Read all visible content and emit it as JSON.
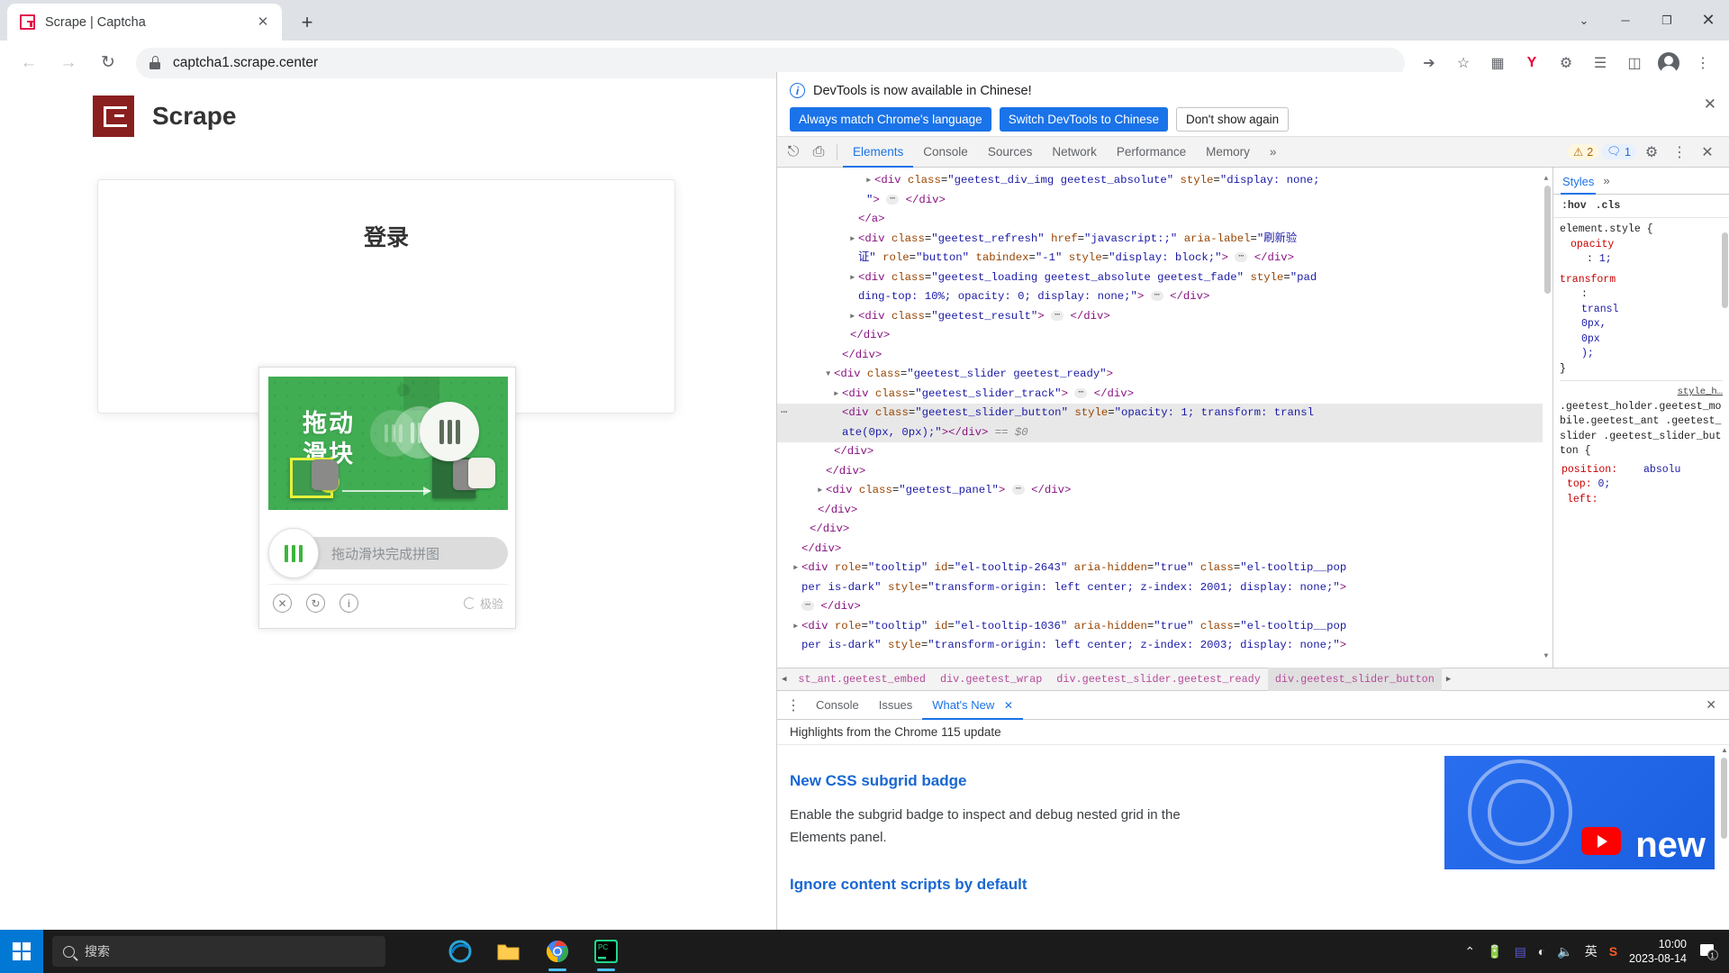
{
  "browser": {
    "tab": {
      "title": "Scrape | Captcha",
      "favicon": "scrape-logo-icon",
      "close": "✕"
    },
    "newtab_label": "+",
    "window_controls": {
      "minimize": "─",
      "maximize": "❐",
      "close": "✕",
      "chevron": "⌄"
    },
    "nav": {
      "back": "←",
      "forward": "→",
      "reload": "↻"
    },
    "omnibox": {
      "url": "captcha1.scrape.center",
      "lock": "lock-icon"
    },
    "toolbar_icons": [
      "share-icon",
      "star-icon",
      "extension-card-icon",
      "yandex-icon",
      "puzzle-icon",
      "reading-list-icon",
      "side-panel-icon",
      "profile-avatar-icon",
      "more-menu-icon"
    ]
  },
  "page": {
    "brand": "Scrape",
    "login_title": "登录",
    "captcha": {
      "image_text_line1": "拖动",
      "image_text_line2": "滑块",
      "slider_placeholder": "拖动滑块完成拼图",
      "footer_icons": [
        "close-icon",
        "refresh-icon",
        "info-icon"
      ],
      "brand": "极验",
      "bg_color": "#41ad53",
      "slider_bar_color": "#3db53d"
    }
  },
  "devtools": {
    "banner": {
      "text": "DevTools is now available in Chinese!",
      "buttons": [
        {
          "label": "Always match Chrome's language",
          "style": "blue"
        },
        {
          "label": "Switch DevTools to Chinese",
          "style": "blue"
        },
        {
          "label": "Don't show again",
          "style": "plain"
        }
      ],
      "close": "✕"
    },
    "tabs": [
      {
        "label": "Elements",
        "active": true
      },
      {
        "label": "Console",
        "active": false
      },
      {
        "label": "Sources",
        "active": false
      },
      {
        "label": "Network",
        "active": false
      },
      {
        "label": "Performance",
        "active": false
      },
      {
        "label": "Memory",
        "active": false
      }
    ],
    "tabs_overflow": "»",
    "badges": {
      "warnings": "2",
      "messages": "1"
    },
    "tab_icons": [
      "inspect-element-icon",
      "device-toolbar-icon",
      "settings-gear-icon",
      "devtools-more-icon",
      "devtools-close-icon"
    ],
    "dom_lines": [
      {
        "indent": 10,
        "tri": "closed",
        "html": "<span class=\"punc\">&lt;</span><span class=\"tagname\">div</span> <span class=\"attr\">class</span>=<span class=\"val\">\"geetest_div_img geetest_absolute\"</span> <span class=\"attr\">style</span>=<span class=\"val\">\"display: none;</span>"
      },
      {
        "indent": 9,
        "tri": "none",
        "html": "<span class=\"val\">\"</span><span class=\"punc\">&gt;</span> <span class=\"ellip\">⋯</span> <span class=\"punc\">&lt;/</span><span class=\"tagname\">div</span><span class=\"punc\">&gt;</span>"
      },
      {
        "indent": 8,
        "tri": "none",
        "html": "<span class=\"punc\">&lt;/</span><span class=\"tagname\">a</span><span class=\"punc\">&gt;</span>"
      },
      {
        "indent": 8,
        "tri": "closed",
        "html": "<span class=\"punc\">&lt;</span><span class=\"tagname\">div</span> <span class=\"attr\">class</span>=<span class=\"val\">\"geetest_refresh\"</span> <span class=\"attr\">href</span>=<span class=\"val\">\"javascript:;\"</span> <span class=\"attr\">aria-label</span>=<span class=\"val\">\"刷新验</span>"
      },
      {
        "indent": 8,
        "tri": "none",
        "html": "<span class=\"val\">证\"</span> <span class=\"attr\">role</span>=<span class=\"val\">\"button\"</span> <span class=\"attr\">tabindex</span>=<span class=\"val\">\"-1\"</span> <span class=\"attr\">style</span>=<span class=\"val\">\"display: block;\"</span><span class=\"punc\">&gt;</span> <span class=\"ellip\">⋯</span> <span class=\"punc\">&lt;/</span><span class=\"tagname\">div</span><span class=\"punc\">&gt;</span>"
      },
      {
        "indent": 8,
        "tri": "closed",
        "html": "<span class=\"punc\">&lt;</span><span class=\"tagname\">div</span> <span class=\"attr\">class</span>=<span class=\"val\">\"geetest_loading geetest_absolute geetest_fade\"</span> <span class=\"attr\">style</span>=<span class=\"val\">\"pad</span>"
      },
      {
        "indent": 8,
        "tri": "none",
        "html": "<span class=\"val\">ding-top: 10%; opacity: 0; display: none;\"</span><span class=\"punc\">&gt;</span> <span class=\"ellip\">⋯</span> <span class=\"punc\">&lt;/</span><span class=\"tagname\">div</span><span class=\"punc\">&gt;</span>"
      },
      {
        "indent": 8,
        "tri": "closed",
        "html": "<span class=\"punc\">&lt;</span><span class=\"tagname\">div</span> <span class=\"attr\">class</span>=<span class=\"val\">\"geetest_result\"</span><span class=\"punc\">&gt;</span> <span class=\"ellip\">⋯</span> <span class=\"punc\">&lt;/</span><span class=\"tagname\">div</span><span class=\"punc\">&gt;</span>"
      },
      {
        "indent": 7,
        "tri": "none",
        "html": "<span class=\"punc\">&lt;/</span><span class=\"tagname\">div</span><span class=\"punc\">&gt;</span>"
      },
      {
        "indent": 6,
        "tri": "none",
        "html": "<span class=\"punc\">&lt;/</span><span class=\"tagname\">div</span><span class=\"punc\">&gt;</span>"
      },
      {
        "indent": 5,
        "tri": "open",
        "html": "<span class=\"punc\">&lt;</span><span class=\"tagname\">div</span> <span class=\"attr\">class</span>=<span class=\"val\">\"geetest_slider geetest_ready\"</span><span class=\"punc\">&gt;</span>"
      },
      {
        "indent": 6,
        "tri": "closed",
        "html": "<span class=\"punc\">&lt;</span><span class=\"tagname\">div</span> <span class=\"attr\">class</span>=<span class=\"val\">\"geetest_slider_track\"</span><span class=\"punc\">&gt;</span> <span class=\"ellip\">⋯</span> <span class=\"punc\">&lt;/</span><span class=\"tagname\">div</span><span class=\"punc\">&gt;</span>"
      },
      {
        "indent": 6,
        "tri": "none",
        "selected": true,
        "html": "<span class=\"punc\">&lt;</span><span class=\"tagname\">div</span> <span class=\"attr\">class</span>=<span class=\"val\">\"geetest_slider_button\"</span> <span class=\"attr\">style</span>=<span class=\"val\">\"opacity: 1; transform: transl</span>"
      },
      {
        "indent": 6,
        "tri": "none",
        "selected": true,
        "html": "<span class=\"val\">ate(0px, 0px);\"</span><span class=\"punc\">&gt;&lt;/</span><span class=\"tagname\">div</span><span class=\"punc\">&gt;</span> <span class=\"sel-marker\">== $0</span>"
      },
      {
        "indent": 5,
        "tri": "none",
        "html": "<span class=\"punc\">&lt;/</span><span class=\"tagname\">div</span><span class=\"punc\">&gt;</span>"
      },
      {
        "indent": 4,
        "tri": "none",
        "html": "<span class=\"punc\">&lt;/</span><span class=\"tagname\">div</span><span class=\"punc\">&gt;</span>"
      },
      {
        "indent": 4,
        "tri": "closed",
        "html": "<span class=\"punc\">&lt;</span><span class=\"tagname\">div</span> <span class=\"attr\">class</span>=<span class=\"val\">\"geetest_panel\"</span><span class=\"punc\">&gt;</span> <span class=\"ellip\">⋯</span> <span class=\"punc\">&lt;/</span><span class=\"tagname\">div</span><span class=\"punc\">&gt;</span>"
      },
      {
        "indent": 3,
        "tri": "none",
        "html": "<span class=\"punc\">&lt;/</span><span class=\"tagname\">div</span><span class=\"punc\">&gt;</span>"
      },
      {
        "indent": 2,
        "tri": "none",
        "html": "<span class=\"punc\">&lt;/</span><span class=\"tagname\">div</span><span class=\"punc\">&gt;</span>"
      },
      {
        "indent": 1,
        "tri": "none",
        "html": "<span class=\"punc\">&lt;/</span><span class=\"tagname\">div</span><span class=\"punc\">&gt;</span>"
      },
      {
        "indent": 1,
        "tri": "closed",
        "html": "<span class=\"punc\">&lt;</span><span class=\"tagname\">div</span> <span class=\"attr\">role</span>=<span class=\"val\">\"tooltip\"</span> <span class=\"attr\">id</span>=<span class=\"val\">\"el-tooltip-2643\"</span> <span class=\"attr\">aria-hidden</span>=<span class=\"val\">\"true\"</span> <span class=\"attr\">class</span>=<span class=\"val\">\"el-tooltip__pop</span>"
      },
      {
        "indent": 1,
        "tri": "none",
        "html": "<span class=\"val\">per is-dark\"</span> <span class=\"attr\">style</span>=<span class=\"val\">\"transform-origin: left center; z-index: 2001; display: none;\"</span><span class=\"punc\">&gt;</span>"
      },
      {
        "indent": 1,
        "tri": "none",
        "html": "<span class=\"ellip\">⋯</span> <span class=\"punc\">&lt;/</span><span class=\"tagname\">div</span><span class=\"punc\">&gt;</span>"
      },
      {
        "indent": 1,
        "tri": "closed",
        "html": "<span class=\"punc\">&lt;</span><span class=\"tagname\">div</span> <span class=\"attr\">role</span>=<span class=\"val\">\"tooltip\"</span> <span class=\"attr\">id</span>=<span class=\"val\">\"el-tooltip-1036\"</span> <span class=\"attr\">aria-hidden</span>=<span class=\"val\">\"true\"</span> <span class=\"attr\">class</span>=<span class=\"val\">\"el-tooltip__pop</span>"
      },
      {
        "indent": 1,
        "tri": "none",
        "html": "<span class=\"val\">per is-dark\"</span> <span class=\"attr\">style</span>=<span class=\"val\">\"transform-origin: left center; z-index: 2003; display: none;\"</span><span class=\"punc\">&gt;</span>"
      }
    ],
    "breadcrumb": {
      "left_arrow": "◀",
      "right_arrow": "▶",
      "items": [
        {
          "label": "st_ant.geetest_embed",
          "current": false
        },
        {
          "label": "div.geetest_wrap",
          "current": false
        },
        {
          "label": "div.geetest_slider.geetest_ready",
          "current": false
        },
        {
          "label": "div.geetest_slider_button",
          "current": true
        }
      ]
    },
    "styles": {
      "panel_tab": "Styles",
      "panel_overflow": "»",
      "filters": [
        ":hov",
        ".cls"
      ],
      "element_style_header": "element.style {",
      "element_style_props": [
        {
          "prop": "opacity",
          "value": "1;"
        },
        {
          "prop": "transform",
          "value": "transl"
        },
        {
          "prop": "",
          "value": "0px,"
        },
        {
          "prop": "",
          "value": "0px"
        },
        {
          "prop": "",
          "value": ");"
        }
      ],
      "element_style_close": "}",
      "rule_source": "style_h…",
      "rule_selector": ".geetest_holder.geetest_mobile.geetest_ant .geetest_slider .geetest_slider_button {",
      "rule_props": [
        {
          "prop": "position:",
          "value": "absolu"
        },
        {
          "prop": "top:",
          "value": "0;"
        },
        {
          "prop": "left:",
          "value": ""
        }
      ]
    },
    "drawer": {
      "menu_icon": "drawer-more-icon",
      "tabs": [
        {
          "label": "Console",
          "active": false
        },
        {
          "label": "Issues",
          "active": false
        },
        {
          "label": "What's New",
          "active": true,
          "close": "✕"
        }
      ],
      "close": "✕",
      "subtitle": "Highlights from the Chrome 115 update",
      "articles": [
        {
          "heading": "New CSS subgrid badge",
          "body": "Enable the subgrid badge to inspect and debug nested grid in the Elements panel."
        },
        {
          "heading": "Ignore content scripts by default",
          "body": ""
        }
      ],
      "thumb_text": "new"
    }
  },
  "taskbar": {
    "start": "windows-start-icon",
    "search_placeholder": "搜索",
    "apps": [
      "edge-icon",
      "file-explorer-icon",
      "chrome-icon",
      "pycharm-icon"
    ],
    "tray_icons": [
      "chevron-up-icon",
      "battery-icon",
      "teams-icon",
      "wifi-icon",
      "volume-icon"
    ],
    "ime": "英",
    "sogou": "S",
    "time": "10:00",
    "date": "2023-08-14",
    "notification_count": "1"
  }
}
